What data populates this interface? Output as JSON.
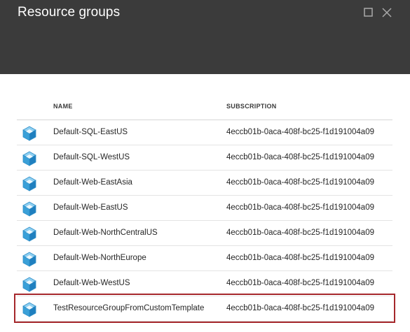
{
  "blade": {
    "title": "Resource groups",
    "maximize_icon": "maximize-icon",
    "close_icon": "close-icon"
  },
  "table": {
    "columns": {
      "name": "NAME",
      "subscription": "SUBSCRIPTION"
    },
    "rows": [
      {
        "name": "Default-SQL-EastUS",
        "subscription": "4eccb01b-0aca-408f-bc25-f1d191004a09",
        "icon": "resource-group-cube-icon"
      },
      {
        "name": "Default-SQL-WestUS",
        "subscription": "4eccb01b-0aca-408f-bc25-f1d191004a09",
        "icon": "resource-group-cube-icon"
      },
      {
        "name": "Default-Web-EastAsia",
        "subscription": "4eccb01b-0aca-408f-bc25-f1d191004a09",
        "icon": "resource-group-cube-icon"
      },
      {
        "name": "Default-Web-EastUS",
        "subscription": "4eccb01b-0aca-408f-bc25-f1d191004a09",
        "icon": "resource-group-cube-icon"
      },
      {
        "name": "Default-Web-NorthCentralUS",
        "subscription": "4eccb01b-0aca-408f-bc25-f1d191004a09",
        "icon": "resource-group-cube-icon"
      },
      {
        "name": "Default-Web-NorthEurope",
        "subscription": "4eccb01b-0aca-408f-bc25-f1d191004a09",
        "icon": "resource-group-cube-icon"
      },
      {
        "name": "Default-Web-WestUS",
        "subscription": "4eccb01b-0aca-408f-bc25-f1d191004a09",
        "icon": "resource-group-cube-icon"
      },
      {
        "name": "TestResourceGroupFromCustomTemplate",
        "subscription": "4eccb01b-0aca-408f-bc25-f1d191004a09",
        "icon": "resource-group-cube-icon"
      }
    ]
  },
  "colors": {
    "header_bg": "#3b3b3b",
    "highlight_border": "#a5272b",
    "icon_blue": "#3aa0d8"
  }
}
